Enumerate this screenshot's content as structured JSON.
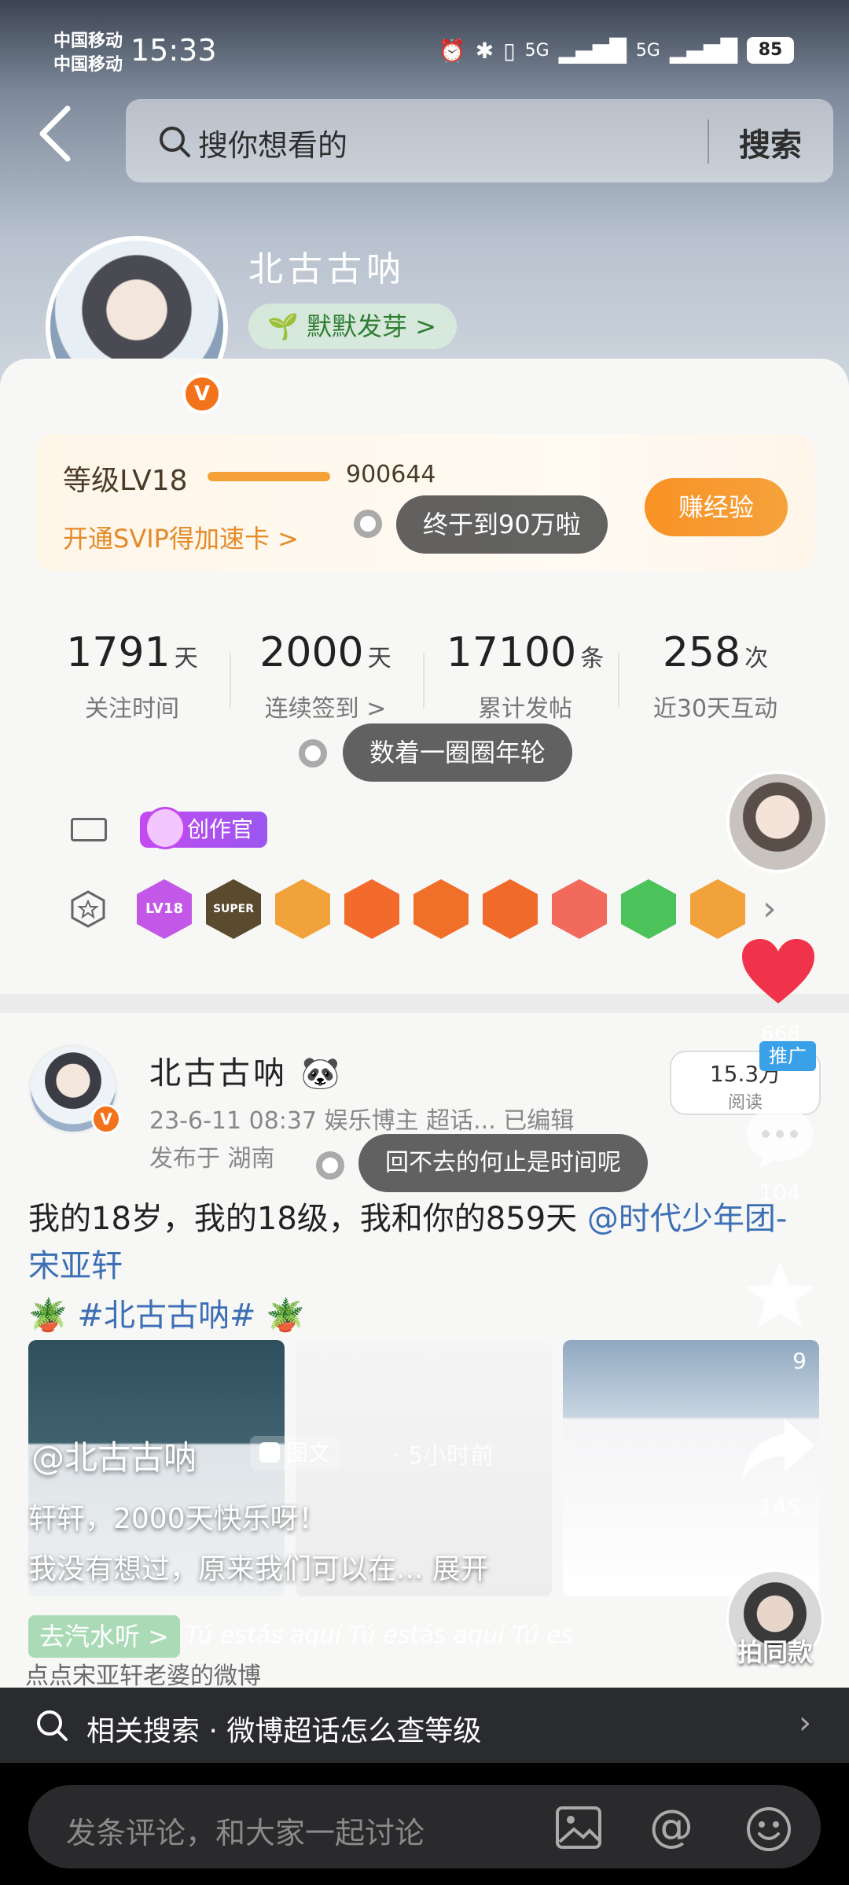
{
  "statusbar": {
    "carrier1": "中国移动",
    "carrier2": "中国移动",
    "time": "15:33",
    "signal1": "5G",
    "signal2": "5G",
    "battery": "85"
  },
  "search": {
    "placeholder": "搜你想看的",
    "button": "搜索"
  },
  "profile": {
    "username": "北古古呐",
    "sprout_label": "默默发芽 >"
  },
  "level": {
    "label": "等级LV18",
    "value": "900644",
    "svip_link": "开通SVIP得加速卡 >",
    "earn_button": "赚经验",
    "progress": 1.0
  },
  "danmaku": {
    "d1": "终于到90万啦",
    "d2": "数着一圈圈年轮",
    "d3": "回不去的何止是时间呢"
  },
  "stats": [
    {
      "value": "1791",
      "unit": "天",
      "label": "关注时间"
    },
    {
      "value": "2000",
      "unit": "天",
      "label": "连续签到 >"
    },
    {
      "value": "17100",
      "unit": "条",
      "label": "累计发帖"
    },
    {
      "value": "258",
      "unit": "次",
      "label": "近30天互动"
    }
  ],
  "badges": {
    "creator": "创作官"
  },
  "medals": {
    "colors": [
      "#c257e8",
      "#5a4a2e",
      "#f2a23a",
      "#f26a2c",
      "#f0702a",
      "#f06a2a",
      "#f26a5c",
      "#4cc25a",
      "#f2a23a"
    ],
    "first_label": "LV18",
    "second_label": "SUPER"
  },
  "post": {
    "author": "北古古呐",
    "meta": "23-6-11 08:37  娱乐博主 超话...  已编辑",
    "location": "发布于 湖南",
    "text_main": "我的18岁，我的18级，我和你的859天 ",
    "mention": "@时代少年团-宋亚轩",
    "topic": "#北古古呐#",
    "image_count": "9"
  },
  "sidebar": {
    "like_count": "668",
    "promo": "推广",
    "read_num": "15.3万",
    "read_label": "阅读",
    "comment_count": "104",
    "share_count": "145",
    "same_style": "拍同款"
  },
  "overlay": {
    "author": "@北古古呐",
    "type": "图文",
    "time": "· 5小时前",
    "caption_line1": "轩轩，2000天快乐呀！",
    "caption_line2": "我没有想过，原来我们可以在... 展开",
    "music_button": "去汽水听 >",
    "music_scroll": "Tú estás aquí    Tú estás aquí    Tú es",
    "source": "点点宋亚轩老婆的微博"
  },
  "related": {
    "text": "相关搜索 · 微博超话怎么查等级"
  },
  "comment_bar": {
    "placeholder": "发条评论，和大家一起讨论"
  },
  "colors": {
    "accent_orange": "#f89225",
    "link_blue": "#3d6fb4",
    "heart_red": "#f0334a"
  }
}
